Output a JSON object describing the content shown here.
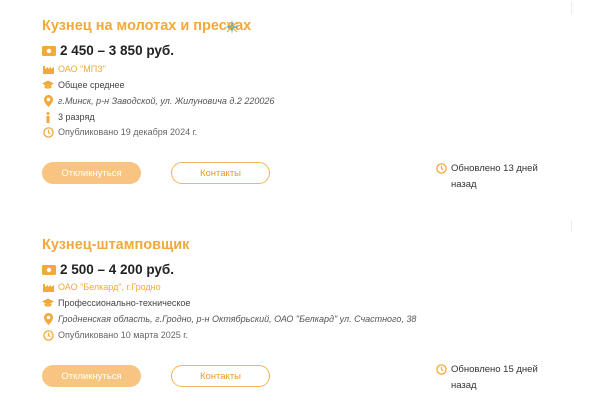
{
  "vacancies": [
    {
      "title": "Кузнец на молотах и прессах",
      "salary": "2 450 – 3 850 руб.",
      "company": "ОАО \"МПЗ\"",
      "education": "Общее среднее",
      "address": "г.Минск, р-н Заводской, ул. Жилуновича д.2 220026",
      "rank": "3 разряд",
      "published": "Опубликовано 19 декабря 2024 г.",
      "apply_label": "Откликнуться",
      "contacts_label": "Контакты",
      "updated": "Обновлено 13 дней назад"
    },
    {
      "title": "Кузнец-штамповщик",
      "salary": "2 500 – 4 200 руб.",
      "company": "ОАО \"Белкард\", г.Гродно",
      "education": "Профессионально-техническое",
      "address": "Гродненская область, г.Гродно, р-н Октябрьский, ОАО \"Белкард\" ул. Счастного, 38",
      "published": "Опубликовано 10 марта 2025 г.",
      "apply_label": "Откликнуться",
      "contacts_label": "Контакты",
      "updated": "Обновлено 15 дней назад"
    }
  ],
  "colors": {
    "accent": "#f2a93b",
    "button_fill": "#f7c581",
    "sparkle": "#2bb3d9"
  },
  "icons": [
    "money-icon",
    "factory-icon",
    "graduation-cap-icon",
    "location-pin-icon",
    "info-icon",
    "clock-icon",
    "sparkle-icon"
  ]
}
